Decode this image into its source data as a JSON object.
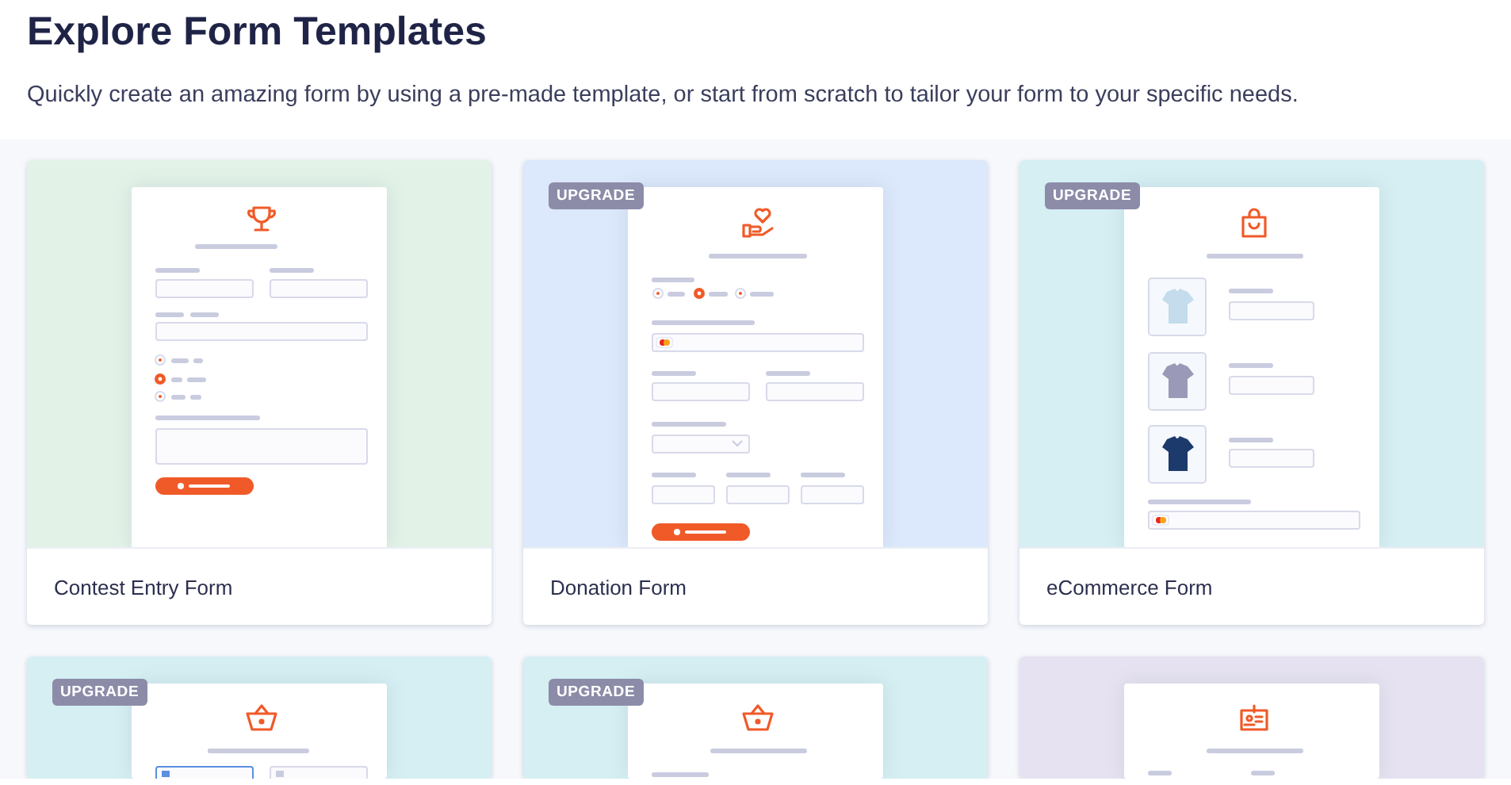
{
  "header": {
    "title": "Explore Form Templates",
    "subtitle": "Quickly create an amazing form by using a pre-made template, or start from scratch to tailor your form to your specific needs."
  },
  "templates": [
    {
      "title": "Contest Entry Form",
      "kind": "contest",
      "color": "#e2f2e7"
    },
    {
      "title": "Donation Form",
      "kind": "donation",
      "color": "#dce8fb",
      "badge": "UPGRADE"
    },
    {
      "title": "eCommerce Form",
      "kind": "ecommerce",
      "color": "#d5eff2",
      "badge": "UPGRADE"
    },
    {
      "kind": "order",
      "color": "#d5eff2",
      "badge": "UPGRADE"
    },
    {
      "kind": "basket",
      "color": "#d5eff2",
      "badge": "UPGRADE"
    },
    {
      "kind": "badge",
      "color": "#e6e2f1"
    }
  ]
}
